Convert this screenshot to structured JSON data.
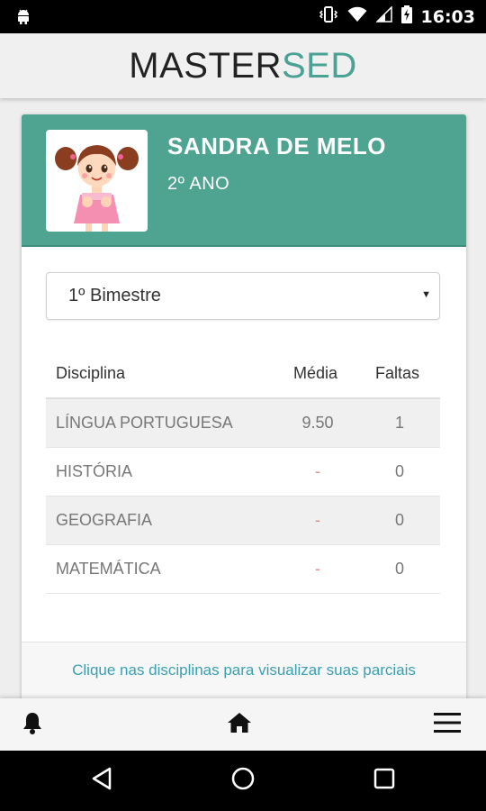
{
  "status_bar": {
    "time": "16:03"
  },
  "header": {
    "brand_part1": "MASTER",
    "brand_part2": "SED"
  },
  "profile": {
    "name": "SANDRA DE MELO",
    "grade": "2º ANO"
  },
  "period_select": {
    "value": "1º Bimestre"
  },
  "table": {
    "headers": {
      "discipline": "Disciplina",
      "average": "Média",
      "absences": "Faltas"
    },
    "rows": [
      {
        "discipline": "LÍNGUA PORTUGUESA",
        "average": "9.50",
        "absences": "1"
      },
      {
        "discipline": "HISTÓRIA",
        "average": "-",
        "absences": "0"
      },
      {
        "discipline": "GEOGRAFIA",
        "average": "-",
        "absences": "0"
      },
      {
        "discipline": "MATEMÁTICA",
        "average": "-",
        "absences": "0"
      }
    ]
  },
  "hint": "Clique nas disciplinas para visualizar suas parciais",
  "colors": {
    "accent": "#4fa391",
    "brand_accent": "#4aa295",
    "link": "#3aa0b0"
  },
  "icons": {
    "bottom_nav": [
      "bell-icon",
      "home-icon",
      "menu-icon"
    ],
    "system_nav": [
      "back-icon",
      "home-circle-icon",
      "recent-apps-icon"
    ]
  }
}
